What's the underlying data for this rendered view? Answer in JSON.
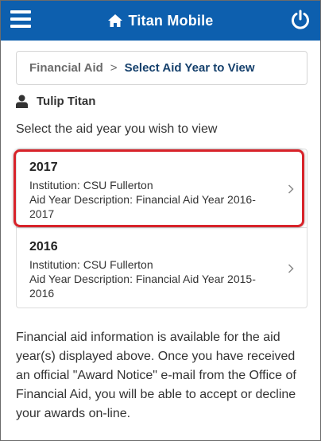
{
  "header": {
    "title": "Titan Mobile",
    "menu_icon": "hamburger-menu-icon",
    "home_icon": "home-icon",
    "power_icon": "power-icon",
    "background_color": "#0d5fae"
  },
  "breadcrumb": {
    "parent": "Financial Aid",
    "separator": ">",
    "current": "Select Aid Year to View"
  },
  "user": {
    "icon": "user-icon",
    "name": "Tulip Titan"
  },
  "prompt": "Select the aid year you wish to view",
  "aid_years": [
    {
      "year": "2017",
      "institution": "Institution: CSU Fullerton",
      "description_line1": "Aid Year Description: Financial Aid Year 2016-",
      "description_line2": "2017",
      "highlighted": true
    },
    {
      "year": "2016",
      "institution": "Institution: CSU Fullerton",
      "description_line1": "Aid Year Description: Financial Aid Year 2015-",
      "description_line2": "2016",
      "highlighted": false
    }
  ],
  "highlight_color": "#d8232a",
  "info_text": "Financial aid information is available for the aid year(s) displayed above. Once you have received an official \"Award Notice\" e-mail from the Office of Financial Aid, you will be able to accept or decline your awards on-line."
}
